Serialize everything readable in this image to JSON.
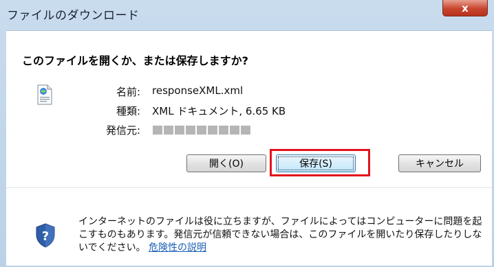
{
  "window": {
    "title": "ファイルのダウンロード",
    "close_label": "x"
  },
  "dialog": {
    "question": "このファイルを開くか、または保存しますか?",
    "file": {
      "name_label": "名前:",
      "name_value": "responseXML.xml",
      "type_label": "種類:",
      "type_value": "XML ドキュメント, 6.65 KB",
      "from_label": "発信元:"
    },
    "buttons": {
      "open": "開く(O)",
      "save": "保存(S)",
      "cancel": "キャンセル"
    },
    "warning": {
      "text": "インターネットのファイルは役に立ちますが、ファイルによってはコンピューターに問題を起こすものもあります。発信元が信頼できない場合は、このファイルを開いたり保存したりしないでください。",
      "link": "危険性の説明"
    }
  },
  "colors": {
    "highlight": "#e2121b",
    "link": "#1a5fb4",
    "close_button": "#c8452e"
  }
}
